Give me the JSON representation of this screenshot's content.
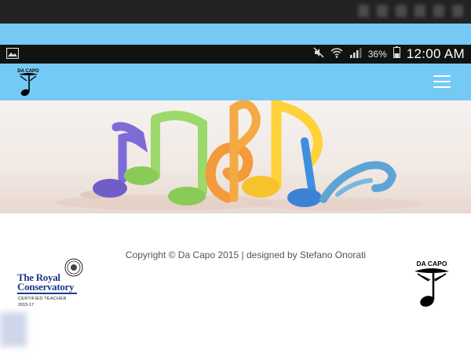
{
  "status_bar": {
    "battery_percent": "36%",
    "time": "12:00 AM",
    "icons": [
      "gallery-icon",
      "mute-icon",
      "wifi-icon",
      "signal-icon",
      "battery-icon"
    ]
  },
  "header": {
    "logo_text": "DA CAPO",
    "menu_icon": "hamburger-menu-icon",
    "background": "#74c9f5"
  },
  "hero": {
    "description_icon": "music-notes-banner"
  },
  "footer": {
    "copyright": "Copyright © Da Capo 2015 | designed by Stefano Onorati",
    "badge_line1": "The Royal",
    "badge_line2": "Conservatory",
    "badge_cert": "CERTIFIED TEACHER",
    "badge_years": "2015-17",
    "logo_text": "DA CAPO"
  }
}
